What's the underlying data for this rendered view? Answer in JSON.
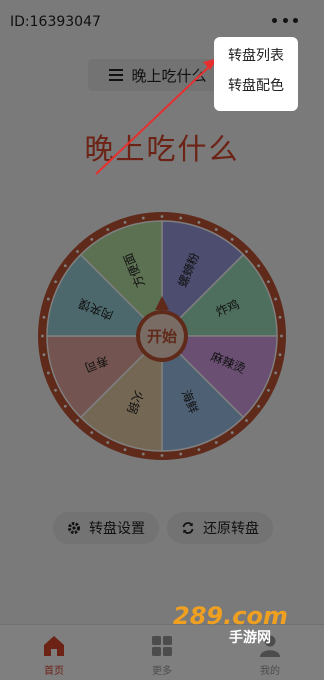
{
  "header": {
    "user_id": "ID:16393047"
  },
  "wheel_title_pill": "晚上吃什么",
  "page_title": "晚上吃什么",
  "wheel": {
    "center_label": "开始",
    "segments": [
      {
        "label": "螺蛳粉",
        "color": "#9a9ae0"
      },
      {
        "label": "炸鸡",
        "color": "#9ddcbc"
      },
      {
        "label": "麻辣烫",
        "color": "#d49ee6"
      },
      {
        "label": "海鲜",
        "color": "#9cc1e6"
      },
      {
        "label": "火锅",
        "color": "#e9d0a8"
      },
      {
        "label": "寿司",
        "color": "#e6a8a0"
      },
      {
        "label": "肉夹馍",
        "color": "#9ad1d8"
      },
      {
        "label": "方便面",
        "color": "#b8e0a5"
      }
    ],
    "rim_color": "#c05536"
  },
  "actions": {
    "settings": "转盘设置",
    "reset": "还原转盘"
  },
  "tabs": [
    {
      "label": "首页",
      "icon": "home-icon",
      "active": true
    },
    {
      "label": "更多",
      "icon": "grid-icon",
      "active": false
    },
    {
      "label": "我的",
      "icon": "person-icon",
      "active": false
    }
  ],
  "popup": {
    "items": [
      "转盘列表",
      "转盘配色"
    ]
  },
  "watermark": {
    "logo": "289.com",
    "sub": "手游网"
  },
  "colors": {
    "accent": "#d8442b"
  }
}
